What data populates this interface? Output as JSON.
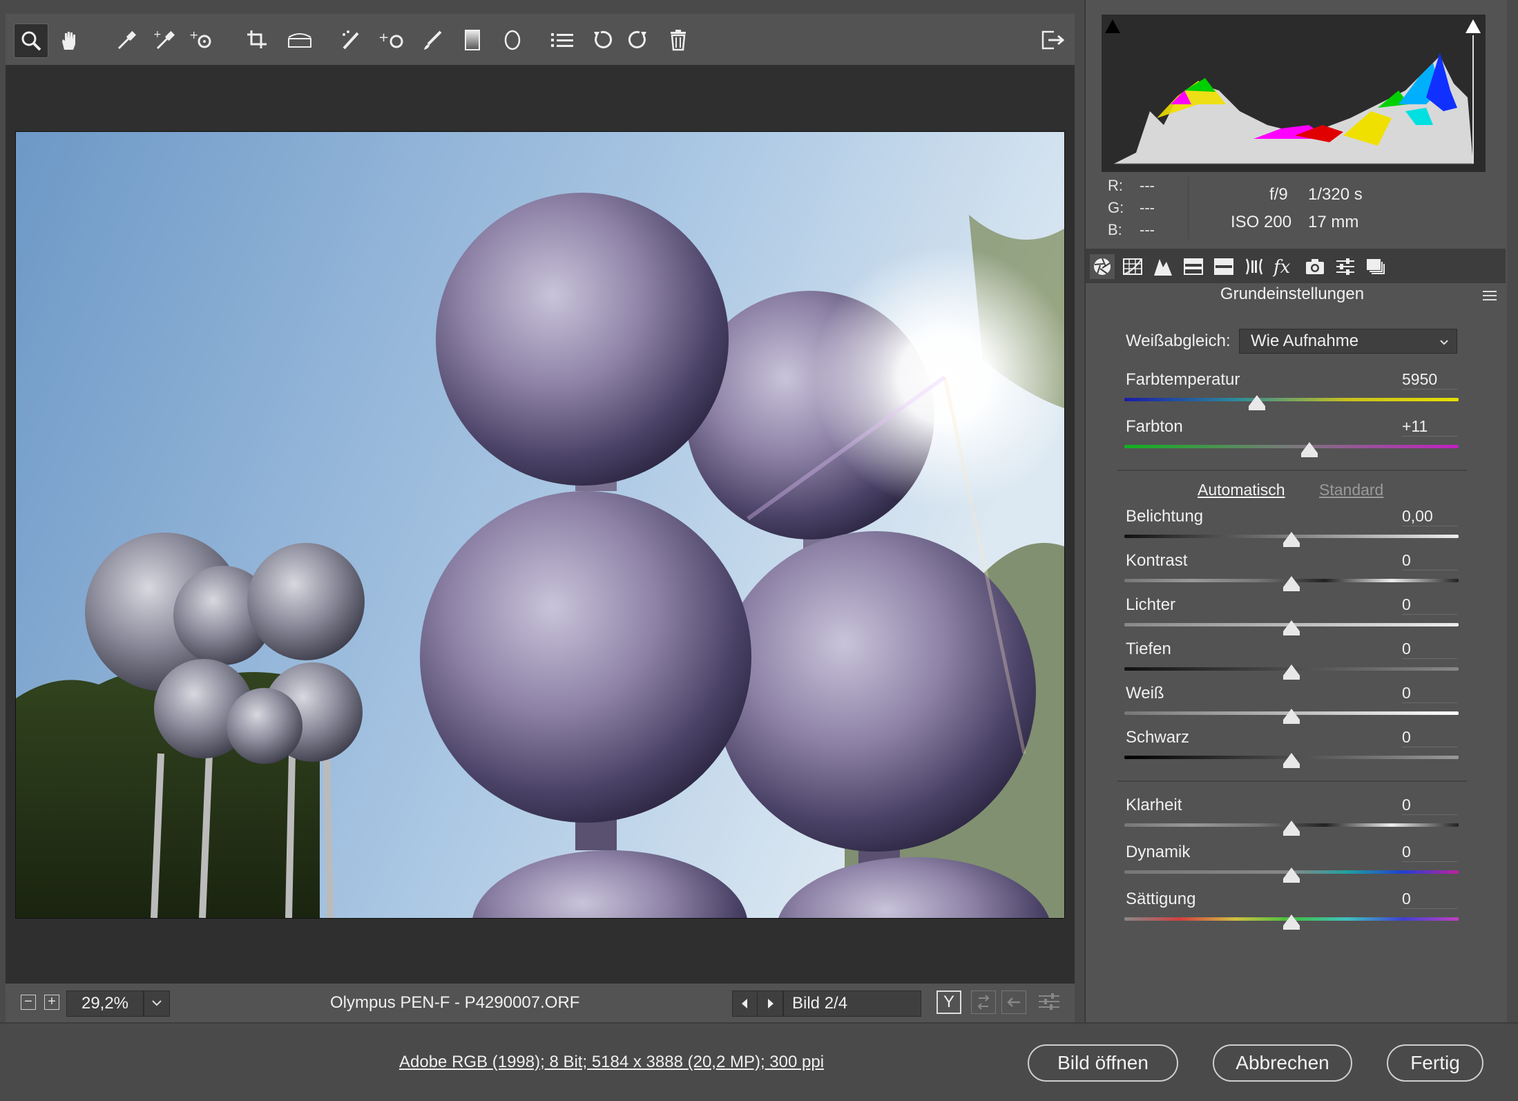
{
  "toolbar": {
    "tools": [
      "zoom-icon",
      "hand-icon",
      "white-balance-icon",
      "color-sampler-icon",
      "targeted-adjustment-icon",
      "crop-icon",
      "straighten-icon",
      "spot-removal-icon",
      "red-eye-icon",
      "adjustment-brush-icon",
      "graduated-filter-icon",
      "radial-filter-icon",
      "list-icon",
      "rotate-ccw-icon",
      "rotate-cw-icon",
      "trash-icon"
    ],
    "export_icon": "export-icon"
  },
  "preview": {
    "zoom_out": "−",
    "zoom_in": "+",
    "zoom_value": "29,2%",
    "filename": "Olympus PEN-F - P4290007.ORF",
    "image_counter": "Bild 2/4",
    "compare_label": "Y"
  },
  "info": {
    "r_label": "R:",
    "r_value": "---",
    "g_label": "G:",
    "g_value": "---",
    "b_label": "B:",
    "b_value": "---",
    "aperture": "f/9",
    "shutter": "1/320 s",
    "iso": "ISO 200",
    "focal": "17 mm"
  },
  "panel": {
    "title": "Grundeinstellungen",
    "white_balance_label": "Weißabgleich:",
    "white_balance_value": "Wie Aufnahme",
    "temp_label": "Farbtemperatur",
    "temp_value": "5950",
    "tint_label": "Farbton",
    "tint_value": "+11",
    "auto_link": "Automatisch",
    "default_link": "Standard",
    "sliders": [
      {
        "label": "Belichtung",
        "value": "0,00"
      },
      {
        "label": "Kontrast",
        "value": "0"
      },
      {
        "label": "Lichter",
        "value": "0"
      },
      {
        "label": "Tiefen",
        "value": "0"
      },
      {
        "label": "Weiß",
        "value": "0"
      },
      {
        "label": "Schwarz",
        "value": "0"
      }
    ],
    "presence": [
      {
        "label": "Klarheit",
        "value": "0"
      },
      {
        "label": "Dynamik",
        "value": "0"
      },
      {
        "label": "Sättigung",
        "value": "0"
      }
    ]
  },
  "footer": {
    "workflow_link": "Adobe RGB (1998); 8 Bit; 5184 x 3888 (20,2 MP); 300 ppi",
    "open_button": "Bild öffnen",
    "cancel_button": "Abbrechen",
    "done_button": "Fertig"
  }
}
